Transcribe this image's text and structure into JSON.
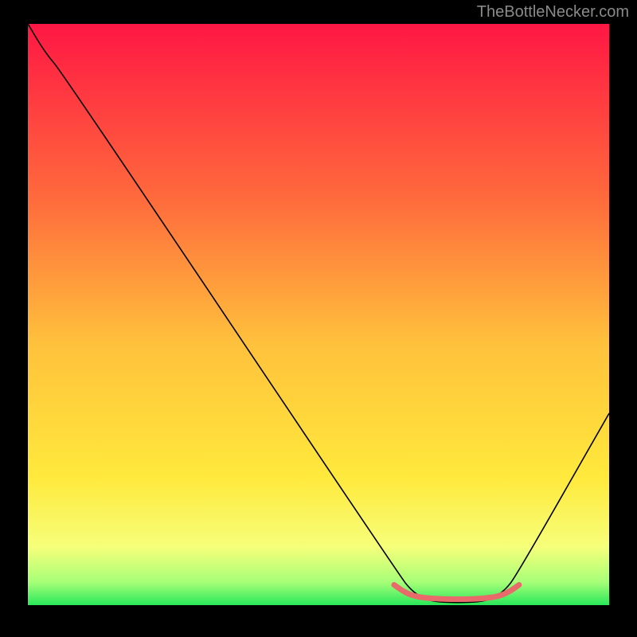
{
  "watermark": "TheBottleNecker.com",
  "chart_data": {
    "type": "line",
    "title": "",
    "xlabel": "",
    "ylabel": "",
    "xlim": [
      0,
      100
    ],
    "ylim": [
      0,
      100
    ],
    "gradient_stops": [
      {
        "offset": 0,
        "color": "#ff1744"
      },
      {
        "offset": 30,
        "color": "#ff6a3c"
      },
      {
        "offset": 55,
        "color": "#ffc13c"
      },
      {
        "offset": 78,
        "color": "#ffe93c"
      },
      {
        "offset": 90,
        "color": "#f6ff7a"
      },
      {
        "offset": 96,
        "color": "#a8ff78"
      },
      {
        "offset": 100,
        "color": "#29e85a"
      }
    ],
    "series": [
      {
        "name": "curve",
        "color": "#000000",
        "width": 1.6,
        "points": [
          {
            "x": 0,
            "y": 100
          },
          {
            "x": 3,
            "y": 95
          },
          {
            "x": 6,
            "y": 91.5
          },
          {
            "x": 64,
            "y": 5
          },
          {
            "x": 66,
            "y": 2.5
          },
          {
            "x": 68,
            "y": 1.2
          },
          {
            "x": 70,
            "y": 0.6
          },
          {
            "x": 74,
            "y": 0.4
          },
          {
            "x": 78,
            "y": 0.6
          },
          {
            "x": 80,
            "y": 1.2
          },
          {
            "x": 82,
            "y": 2.5
          },
          {
            "x": 84,
            "y": 5
          },
          {
            "x": 100,
            "y": 33
          }
        ]
      },
      {
        "name": "bottom-band",
        "color": "#e96a6a",
        "width": 7,
        "points": [
          {
            "x": 63,
            "y": 3.5
          },
          {
            "x": 65,
            "y": 2.1
          },
          {
            "x": 67,
            "y": 1.4
          },
          {
            "x": 70,
            "y": 1.1
          },
          {
            "x": 74,
            "y": 1.0
          },
          {
            "x": 78,
            "y": 1.1
          },
          {
            "x": 81,
            "y": 1.5
          },
          {
            "x": 83,
            "y": 2.4
          },
          {
            "x": 84.5,
            "y": 3.5
          }
        ]
      }
    ]
  }
}
